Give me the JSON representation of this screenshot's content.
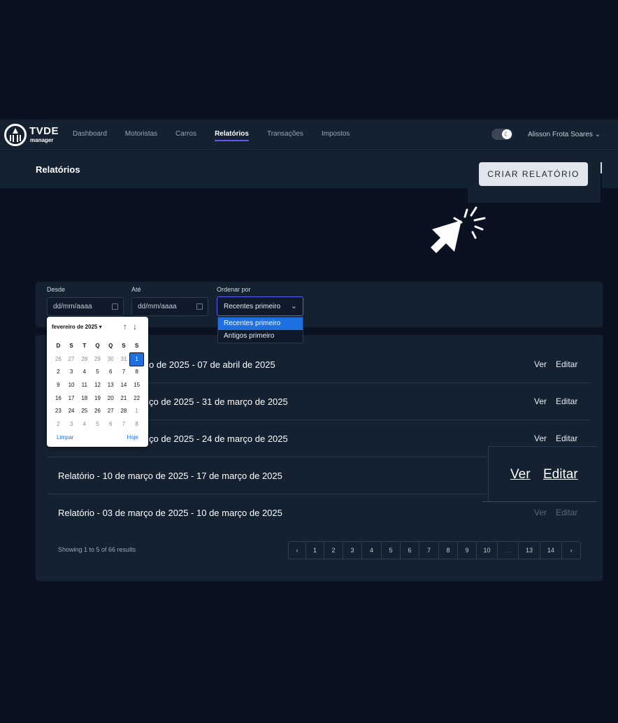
{
  "brand": {
    "name": "TVDE",
    "sub": "manager"
  },
  "nav": {
    "items": [
      {
        "label": "Dashboard",
        "active": false
      },
      {
        "label": "Motoristas",
        "active": false
      },
      {
        "label": "Carros",
        "active": false
      },
      {
        "label": "Relatórios",
        "active": true
      },
      {
        "label": "Transações",
        "active": false
      },
      {
        "label": "Impostos",
        "active": false
      }
    ],
    "user": "Alisson Frota Soares ⌄",
    "theme_toggle_icon": "moon-icon"
  },
  "header": {
    "title": "Relatórios",
    "create_button": "CRIAR RELATÓRIO"
  },
  "filters": {
    "from_label": "Desde",
    "from_placeholder": "dd/mm/aaaa",
    "to_label": "Até",
    "to_placeholder": "dd/mm/aaaa",
    "order_label": "Ordenar por",
    "order_value": "Recentes primeiro",
    "order_options": [
      "Recentes primeiro",
      "Antigos primeiro"
    ]
  },
  "calendar": {
    "title": "fevereiro de 2025 ▾",
    "weekdays": [
      "D",
      "S",
      "T",
      "Q",
      "Q",
      "S",
      "S"
    ],
    "days": [
      [
        "26",
        "27",
        "28",
        "29",
        "30",
        "31",
        "1"
      ],
      [
        "2",
        "3",
        "4",
        "5",
        "6",
        "7",
        "8"
      ],
      [
        "9",
        "10",
        "11",
        "12",
        "13",
        "14",
        "15"
      ],
      [
        "16",
        "17",
        "18",
        "19",
        "20",
        "21",
        "22"
      ],
      [
        "23",
        "24",
        "25",
        "26",
        "27",
        "28",
        "1"
      ],
      [
        "2",
        "3",
        "4",
        "5",
        "6",
        "7",
        "8"
      ]
    ],
    "clear": "Limpar",
    "today": "Hoje"
  },
  "reports": [
    {
      "title": "Relatório - 31 de março de 2025 - 07 de abril de 2025",
      "visible_title": "o de 2025 - 07 de abril de 2025",
      "view": "Ver",
      "edit": "Editar"
    },
    {
      "title": "Relatório - 24 de março de 2025 - 31 de março de 2025",
      "visible_title": "ço de 2025 - 31 de março de 2025",
      "view": "Ver",
      "edit": "Editar"
    },
    {
      "title": "Relatório - 17 de março de 2025 - 24 de março de 2025",
      "visible_title": "ço de 2025 - 24 de março de 2025",
      "view": "Ver",
      "edit": "Editar"
    },
    {
      "title": "Relatório - 10 de março de 2025 - 17 de março de 2025",
      "visible_title": "Relatório - 10 de março de 2025 - 17 de março de 2025",
      "view": "Ver",
      "edit": "Editar"
    },
    {
      "title": "Relatório - 03 de março de 2025 - 10 de março de 2025",
      "visible_title": "Relatório - 03 de março de 2025 - 10 de março de 2025",
      "view": "Ver",
      "edit": "Editar"
    }
  ],
  "pagination": {
    "showing": "Showing 1 to 5 of 66 results",
    "pages": [
      "‹",
      "1",
      "2",
      "3",
      "4",
      "5",
      "6",
      "7",
      "8",
      "9",
      "10",
      "...",
      "13",
      "14",
      "›"
    ]
  }
}
